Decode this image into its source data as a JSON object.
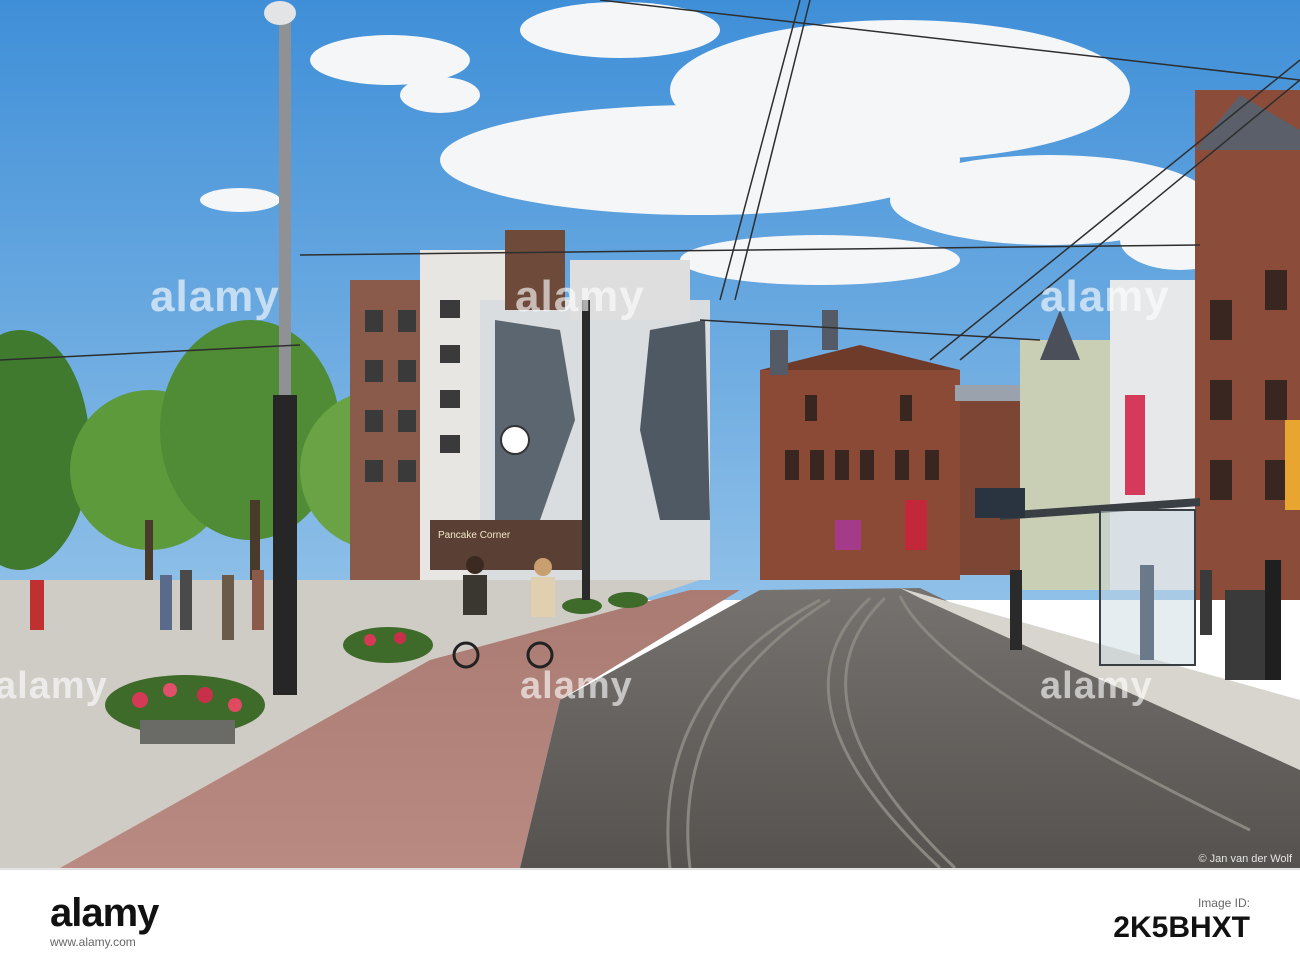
{
  "photo": {
    "mural_caption": "Pancake Corner",
    "photo_credit": "© Jan van der Wolf",
    "watermarks": [
      "alamy",
      "alamy",
      "alamy",
      "alamy",
      "alamy",
      "alamy"
    ]
  },
  "footer": {
    "logo": "alamy",
    "image_id_label": "Image ID:",
    "image_id": "2K5BHXT",
    "url": "www.alamy.com"
  },
  "colors": {
    "sky": "#3f8fd8",
    "brick": "#8a4a35",
    "bike_path": "#b98a82",
    "tram_road": "#5f5c5a"
  }
}
